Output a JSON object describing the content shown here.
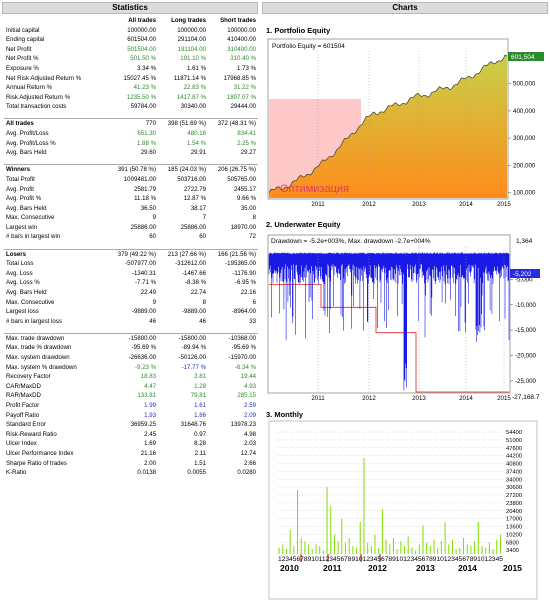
{
  "stats": {
    "title": "Statistics",
    "columns": [
      "All trades",
      "Long trades",
      "Short trades"
    ],
    "rows": [
      {
        "label": "Initial capital",
        "v": [
          "100000.00",
          "100000.00",
          "100000.00"
        ]
      },
      {
        "label": "Ending capital",
        "v": [
          "601504.00",
          "291104.00",
          "410400.00"
        ]
      },
      {
        "label": "Net Profit",
        "v": [
          "501504.00",
          "191104.00",
          "310400.00"
        ],
        "color": "green"
      },
      {
        "label": "Net Profit %",
        "v": [
          "501.50 %",
          "191.10 %",
          "310.40 %"
        ],
        "color": "green"
      },
      {
        "label": "Exposure %",
        "v": [
          "3.34 %",
          "1.61 %",
          "1.73 %"
        ]
      },
      {
        "label": "Net Risk Adjusted Return %",
        "v": [
          "15027.45 %",
          "11871.14 %",
          "17968.85 %"
        ]
      },
      {
        "label": "Annual Return %",
        "v": [
          "41.23 %",
          "22.83 %",
          "31.22 %"
        ],
        "color": "green"
      },
      {
        "label": "Risk Adjusted Return %",
        "v": [
          "1235.50 %",
          "1417.87 %",
          "1807.07 %"
        ],
        "color": "green"
      },
      {
        "label": "Total transaction costs",
        "v": [
          "59784.00",
          "30340.00",
          "29444.00"
        ]
      },
      {
        "sep": true
      },
      {
        "label": "All trades",
        "v": [
          "770",
          "398 (51.69 %)",
          "372 (48.31 %)"
        ],
        "section": true
      },
      {
        "label": "Avg. Profit/Loss",
        "v": [
          "651.30",
          "480.16",
          "834.41"
        ],
        "color": "green"
      },
      {
        "label": "Avg. Profit/Loss %",
        "v": [
          "1.88 %",
          "1.54 %",
          "2.25 %"
        ],
        "color": "green"
      },
      {
        "label": "Avg. Bars Held",
        "v": [
          "29.60",
          "29.91",
          "29.27"
        ]
      },
      {
        "sep": true
      },
      {
        "label": "Winners",
        "v": [
          "391 (50.78 %)",
          "185 (24.03 %)",
          "206 (26.75 %)"
        ],
        "section": true
      },
      {
        "label": "Total Profit",
        "v": [
          "1009481.00",
          "503716.00",
          "505765.00"
        ]
      },
      {
        "label": "Avg. Profit",
        "v": [
          "2581.79",
          "2722.79",
          "2455.17"
        ]
      },
      {
        "label": "Avg. Profit %",
        "v": [
          "11.18 %",
          "12.87 %",
          "9.66 %"
        ]
      },
      {
        "label": "Avg. Bars Held",
        "v": [
          "36.50",
          "38.17",
          "35.00"
        ]
      },
      {
        "label": "Max. Consecutive",
        "v": [
          "9",
          "7",
          "8"
        ]
      },
      {
        "label": "Largest win",
        "v": [
          "25886.00",
          "25886.00",
          "18970.00"
        ]
      },
      {
        "label": "# bars in largest win",
        "v": [
          "60",
          "60",
          "72"
        ]
      },
      {
        "sep": true
      },
      {
        "label": "Losers",
        "v": [
          "379 (49.22 %)",
          "213 (27.66 %)",
          "166 (21.56 %)"
        ],
        "section": true
      },
      {
        "label": "Total Loss",
        "v": [
          "-507977.00",
          "-312612.00",
          "-195365.00"
        ]
      },
      {
        "label": "Avg. Loss",
        "v": [
          "-1340.31",
          "-1467.66",
          "-1176.90"
        ]
      },
      {
        "label": "Avg. Loss %",
        "v": [
          "-7.71 %",
          "-8.38 %",
          "-6.95 %"
        ]
      },
      {
        "label": "Avg. Bars Held",
        "v": [
          "22.49",
          "22.74",
          "22.16"
        ]
      },
      {
        "label": "Max. Consecutive",
        "v": [
          "9",
          "8",
          "6"
        ]
      },
      {
        "label": "Largest loss",
        "v": [
          "-9889.00",
          "-9889.00",
          "-8964.00"
        ]
      },
      {
        "label": "# bars in largest loss",
        "v": [
          "46",
          "46",
          "33"
        ]
      },
      {
        "sep": true
      },
      {
        "label": "Max. trade drawdown",
        "v": [
          "-15800.00",
          "-15800.00",
          "-10368.00"
        ],
        "group": true
      },
      {
        "label": "Max. trade % drawdown",
        "v": [
          "-95.69 %",
          "-89.94 %",
          "-95.69 %"
        ]
      },
      {
        "label": "Max. system drawdown",
        "v": [
          "-26636.00",
          "-50126.00",
          "-15970.00"
        ]
      },
      {
        "label": "Max. system % drawdown",
        "v": [
          "-9.23 %",
          "-17.77 %",
          "-6.34 %"
        ],
        "color": "green",
        "colors": [
          "green",
          "blue",
          "green"
        ]
      },
      {
        "label": "Recovery Factor",
        "v": [
          "18.83",
          "3.81",
          "19.44"
        ],
        "color": "green"
      },
      {
        "label": "CAR/MaxDD",
        "v": [
          "4.47",
          "1.28",
          "4.93"
        ],
        "color": "green"
      },
      {
        "label": "RAR/MaxDD",
        "v": [
          "133.81",
          "79.81",
          "285.15"
        ],
        "color": "green"
      },
      {
        "label": "Profit Factor",
        "v": [
          "1.99",
          "1.61",
          "2.59"
        ],
        "color": "blue"
      },
      {
        "label": "Payoff Ratio",
        "v": [
          "1.93",
          "1.86",
          "2.09"
        ],
        "color": "blue"
      },
      {
        "label": "Standard Error",
        "v": [
          "36959.25",
          "31648.76",
          "13978.23"
        ]
      },
      {
        "label": "Risk-Reward Ratio",
        "v": [
          "2.45",
          "0.97",
          "4.98"
        ]
      },
      {
        "label": "Ulcer Index",
        "v": [
          "1.69",
          "8.28",
          "2.03"
        ]
      },
      {
        "label": "Ulcer Performance Index",
        "v": [
          "21.16",
          "2.11",
          "12.74"
        ]
      },
      {
        "label": "Sharpe Ratio of trades",
        "v": [
          "2.00",
          "1.51",
          "2.66"
        ]
      },
      {
        "label": "K-Ratio",
        "v": [
          "0.0138",
          "0.0055",
          "0.0280"
        ]
      }
    ]
  },
  "charts": {
    "title": "Charts",
    "equity": {
      "title": "1. Portfolio Equity",
      "legend": "Portfolio Equity = 601504",
      "last_value": "601,504",
      "optimization_label": "Оптимизация",
      "y_ticks": [
        "100,000",
        "200,000",
        "300,000",
        "400,000",
        "500,000"
      ],
      "x_ticks": [
        "2011",
        "2012",
        "2013",
        "2014",
        "2015"
      ],
      "colors": {
        "fill_top": "#c8d04a",
        "fill_bottom": "#ff8c1a",
        "line": "#3a3a3a",
        "opt_zone": "#ffb0b0",
        "badge": "#2d8a2d"
      }
    },
    "underwater": {
      "title": "2. Underwater Equity",
      "legend": "Drawdown = -5.2e+003%, Max. drawdown -2.7e+004%",
      "top_value": "1,364",
      "last_value": "-5,202",
      "min_value": "-27,168.7",
      "y_ticks": [
        "-5,000",
        "-10,000",
        "-15,000",
        "-20,000",
        "-25,000"
      ],
      "x_ticks": [
        "2011",
        "2012",
        "2013",
        "2014",
        "2015"
      ],
      "colors": {
        "line": "#1a1ae6",
        "maxdd": "#e02020",
        "badge": "#2a2ae0"
      }
    },
    "monthly": {
      "title": "3. Monthly",
      "y_ticks": [
        "54400",
        "51000",
        "47600",
        "44200",
        "40800",
        "37400",
        "34000",
        "30600",
        "27200",
        "23800",
        "20400",
        "17000",
        "13600",
        "10200",
        "6800",
        "3400"
      ],
      "year_labels": [
        "2010",
        "2011",
        "2012",
        "2013",
        "2014",
        "2015"
      ],
      "month_strip": "1234567891011234567891012345678910123456789101234567891012345",
      "colors": {
        "pos": "#80e000",
        "neg": "#e02020"
      }
    }
  },
  "chart_data": [
    {
      "type": "area",
      "title": "1. Portfolio Equity",
      "series": [
        {
          "name": "Portfolio Equity",
          "x": [
            "2010-07",
            "2010-10",
            "2011-01",
            "2011-04",
            "2011-07",
            "2011-10",
            "2012-01",
            "2012-04",
            "2012-07",
            "2012-10",
            "2013-01",
            "2013-04",
            "2013-07",
            "2013-10",
            "2014-01",
            "2014-04",
            "2014-07",
            "2014-10",
            "2015-01"
          ],
          "values": [
            100000,
            118000,
            140000,
            172000,
            205000,
            252000,
            300000,
            355000,
            392000,
            410000,
            428000,
            450000,
            462000,
            478000,
            495000,
            520000,
            548000,
            580000,
            601504
          ]
        }
      ],
      "ylim": [
        80000,
        620000
      ]
    },
    {
      "type": "line",
      "title": "2. Underwater Equity",
      "series": [
        {
          "name": "Drawdown",
          "x": [
            "2011",
            "2012",
            "2013",
            "2014",
            "2015"
          ],
          "values": [
            -5000,
            -8000,
            -27168.7,
            -15000,
            -5202
          ]
        }
      ],
      "ylim": [
        -27168.7,
        1364
      ]
    }
  ]
}
